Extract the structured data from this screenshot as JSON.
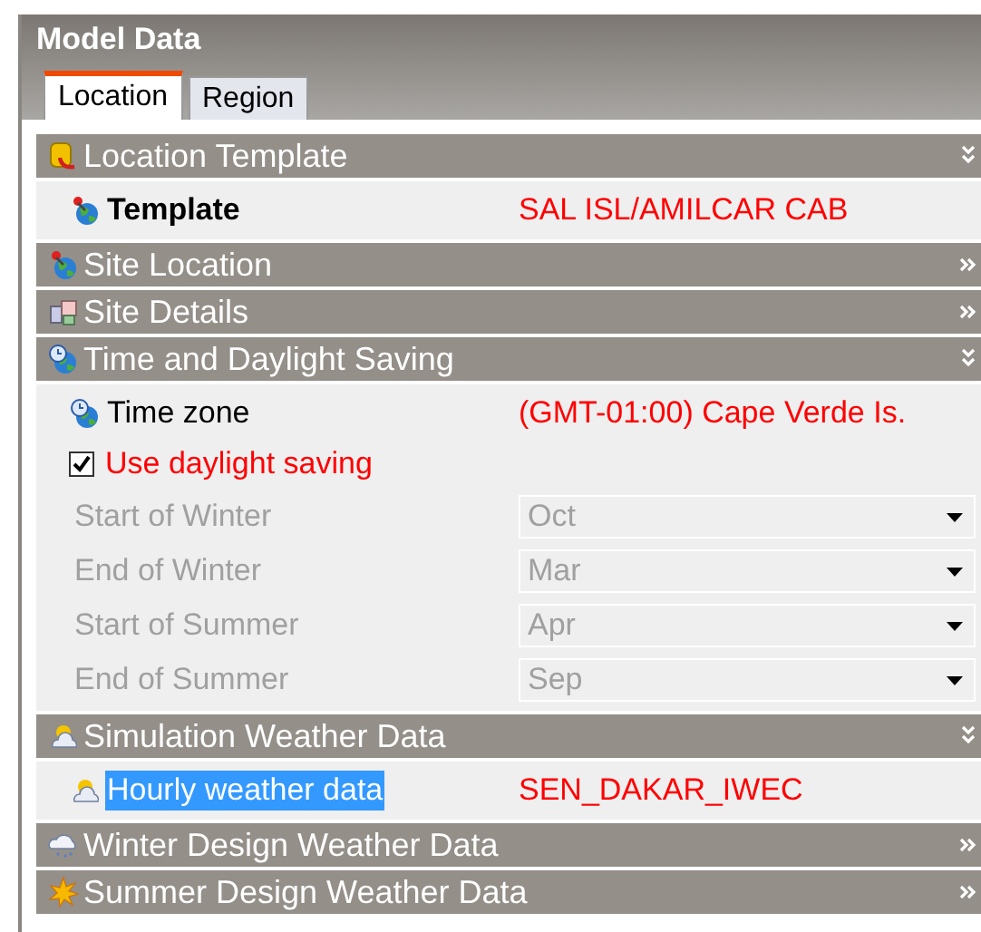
{
  "window": {
    "title": "Model Data"
  },
  "tabs": [
    {
      "label": "Location",
      "selected": true
    },
    {
      "label": "Region",
      "selected": false
    }
  ],
  "sections": [
    {
      "title": "Location Template",
      "expanded": true,
      "rows": [
        {
          "kind": "property",
          "label": "Template",
          "value": "SAL ISL/AMILCAR CAB",
          "bold": true,
          "selected": false
        }
      ]
    },
    {
      "title": "Site Location",
      "expanded": false
    },
    {
      "title": "Site Details",
      "expanded": false
    },
    {
      "title": "Time and Daylight Saving",
      "expanded": true,
      "rows": [
        {
          "kind": "property",
          "label": "Time zone",
          "value": "(GMT-01:00) Cape Verde Is.",
          "bold": false,
          "selected": false
        },
        {
          "kind": "checkbox",
          "label": "Use daylight saving",
          "checked": true
        },
        {
          "kind": "dropdown",
          "label": "Start of Winter",
          "value": "Oct",
          "disabled": true
        },
        {
          "kind": "dropdown",
          "label": "End of Winter",
          "value": "Mar",
          "disabled": true
        },
        {
          "kind": "dropdown",
          "label": "Start of Summer",
          "value": "Apr",
          "disabled": true
        },
        {
          "kind": "dropdown",
          "label": "End of Summer",
          "value": "Sep",
          "disabled": true
        }
      ]
    },
    {
      "title": "Simulation Weather Data",
      "expanded": true,
      "rows": [
        {
          "kind": "property",
          "label": "Hourly weather data",
          "value": "SEN_DAKAR_IWEC",
          "bold": false,
          "selected": true
        }
      ]
    },
    {
      "title": "Winter Design Weather Data",
      "expanded": false
    },
    {
      "title": "Summer Design Weather Data",
      "expanded": false
    }
  ]
}
